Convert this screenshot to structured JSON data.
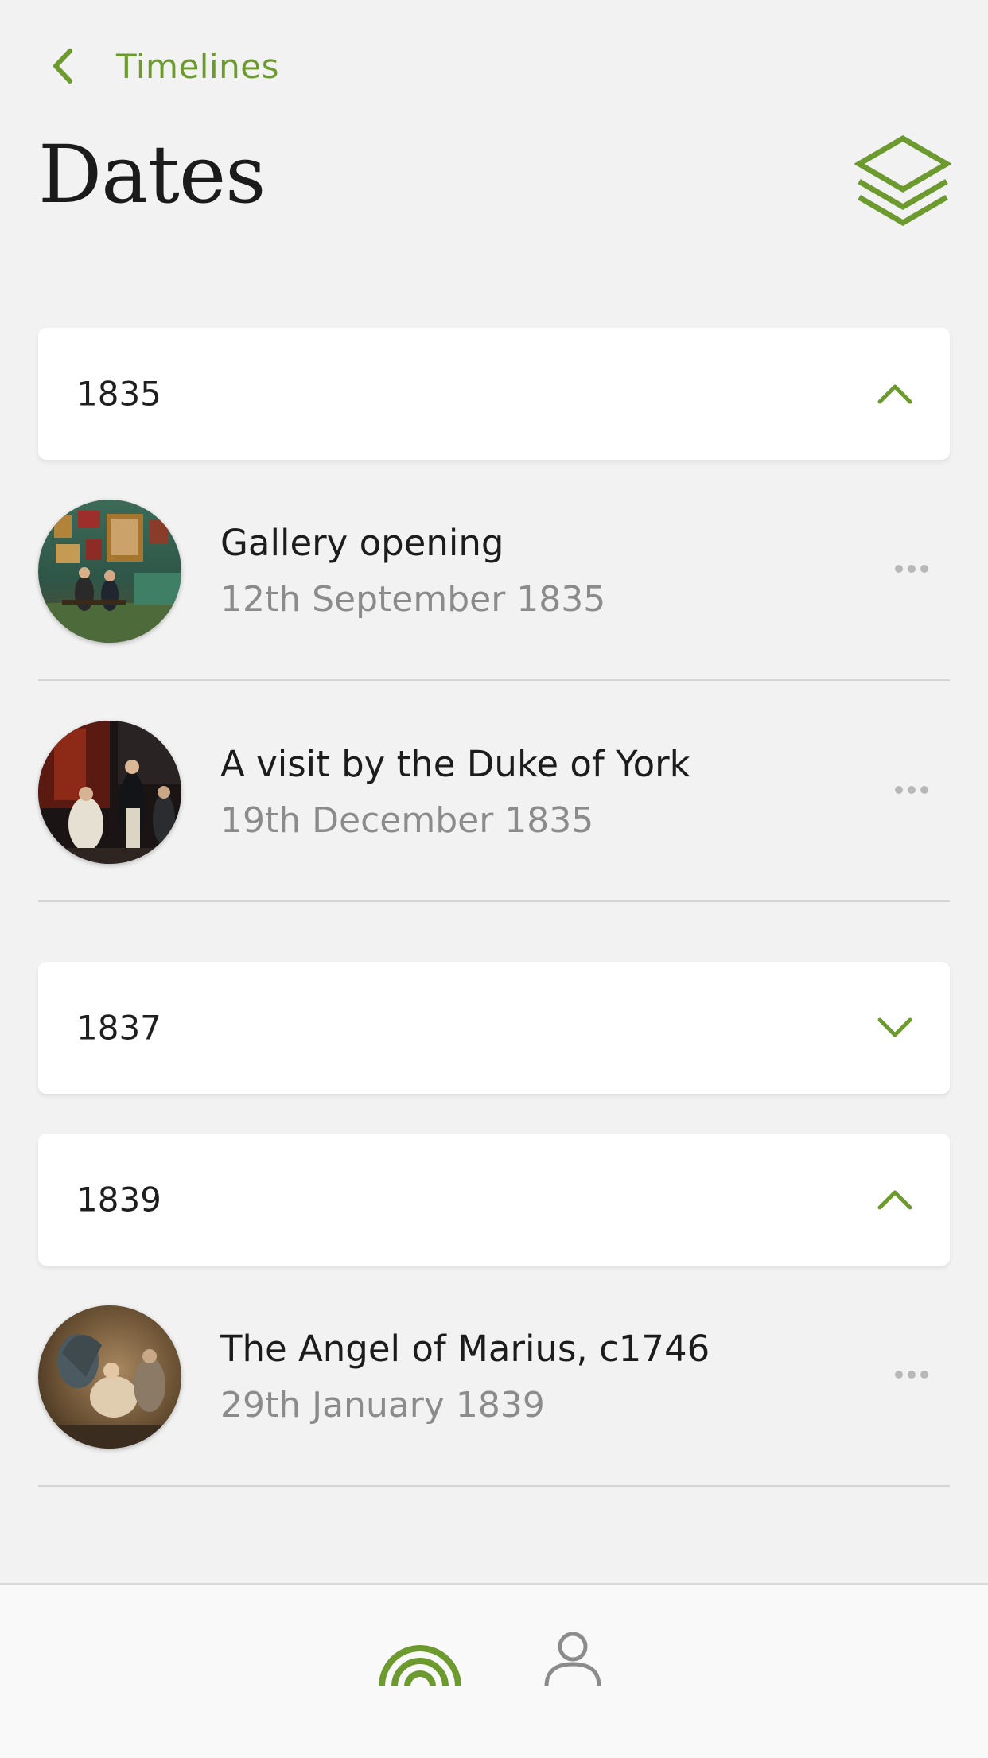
{
  "header": {
    "back_label": "Timelines",
    "title": "Dates",
    "layers_icon": "layers-icon"
  },
  "groups": [
    {
      "year": "1835",
      "expanded": true,
      "items": [
        {
          "title": "Gallery opening",
          "date": "12th September 1835"
        },
        {
          "title": "A visit by the Duke of York",
          "date": "19th December 1835"
        }
      ]
    },
    {
      "year": "1837",
      "expanded": false,
      "items": []
    },
    {
      "year": "1839",
      "expanded": true,
      "items": [
        {
          "title": "The Angel of Marius, c1746",
          "date": "29th January 1839"
        }
      ]
    }
  ],
  "tabbar": {
    "tabs": [
      {
        "icon": "rainbow-timeline-icon",
        "active": true
      },
      {
        "icon": "person-icon",
        "active": false
      }
    ]
  },
  "colors": {
    "accent": "#6c9a2f",
    "background": "#f2f2f2",
    "card": "#ffffff",
    "secondary_text": "#8b8b8b"
  }
}
